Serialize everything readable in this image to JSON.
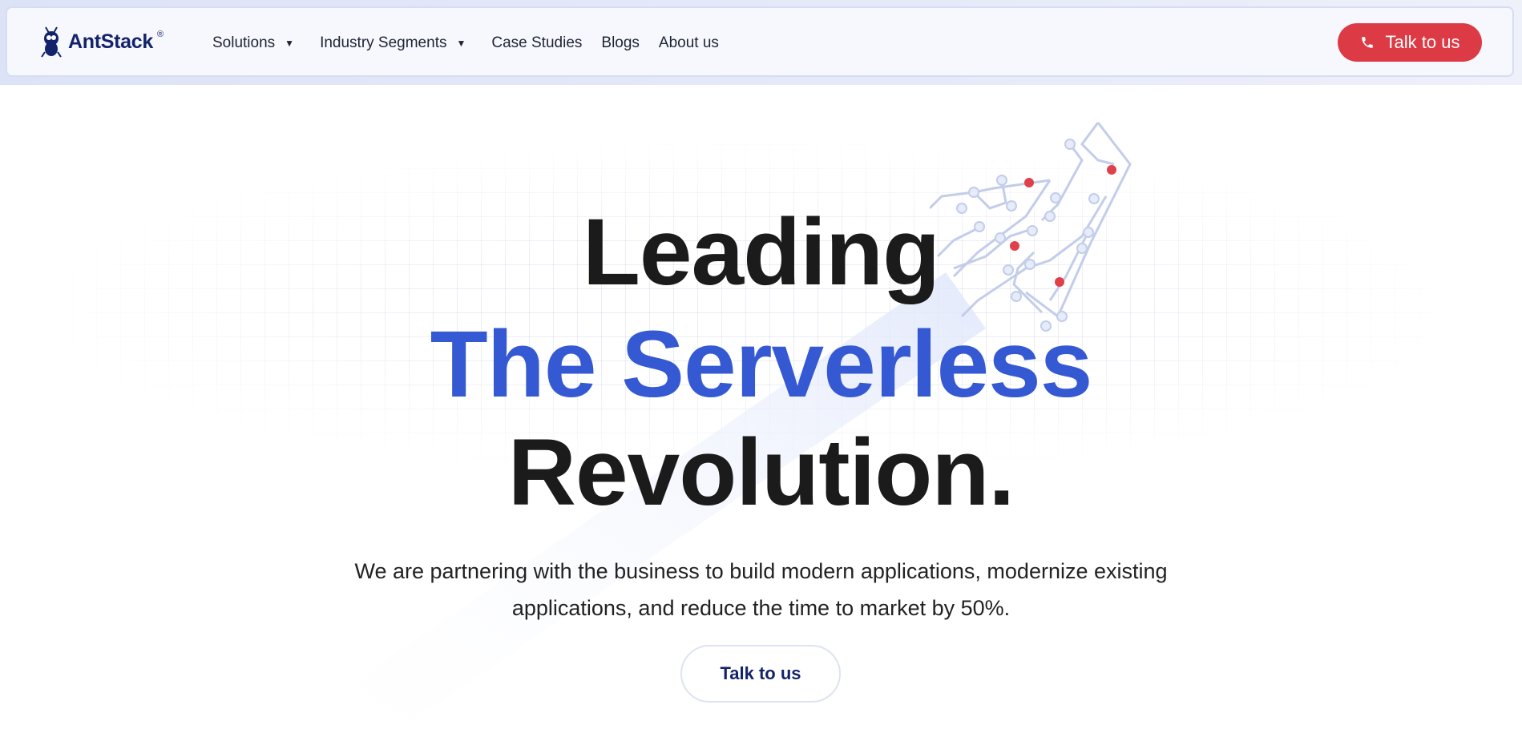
{
  "brand": {
    "name": "AntStack",
    "reg_mark": "®"
  },
  "nav": {
    "items": [
      {
        "label": "Solutions",
        "has_dropdown": true
      },
      {
        "label": "Industry Segments",
        "has_dropdown": true
      },
      {
        "label": "Case Studies",
        "has_dropdown": false
      },
      {
        "label": "Blogs",
        "has_dropdown": false
      },
      {
        "label": "About us",
        "has_dropdown": false
      }
    ],
    "cta_label": "Talk to us",
    "cta_icon": "phone-icon"
  },
  "hero": {
    "line1": "Leading",
    "line2": "The Serverless",
    "line3": "Revolution.",
    "subtitle_line1": "We are partnering with the business to build modern applications, modernize existing",
    "subtitle_line2": "applications, and reduce the time to market by 50%.",
    "cta_label": "Talk to us"
  },
  "colors": {
    "accent_blue": "#3459d3",
    "brand_navy": "#13236b",
    "cta_red": "#dc3b45",
    "nav_bg": "#f6f8fd"
  }
}
